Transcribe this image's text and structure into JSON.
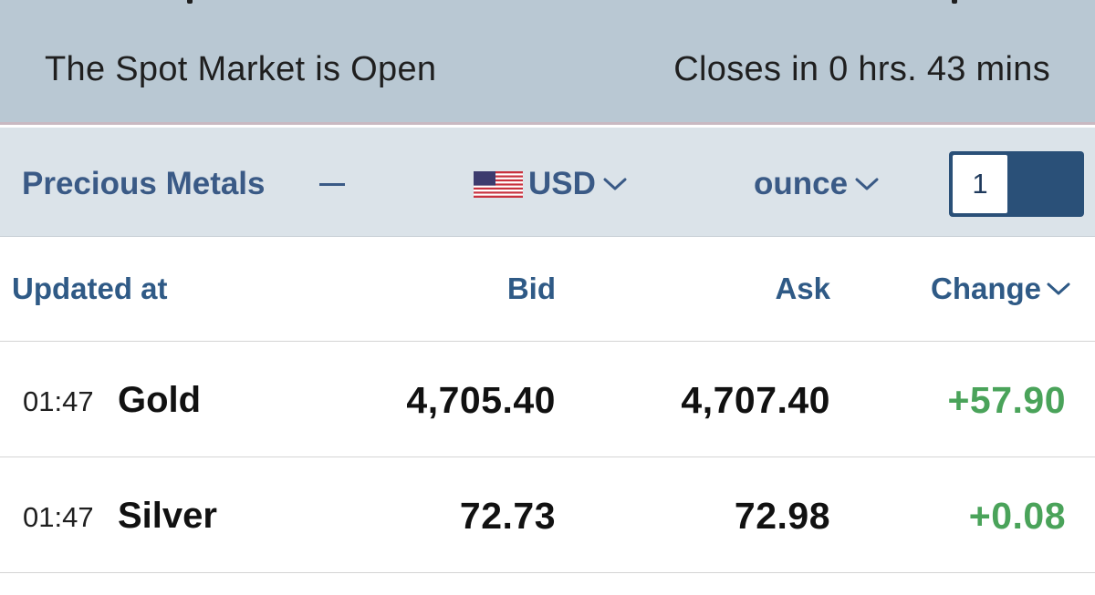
{
  "status": {
    "market_state": "The Spot Market is Open",
    "closing_countdown": "Closes in 0 hrs. 43 mins"
  },
  "filters": {
    "category": "Precious Metals",
    "currency": "USD",
    "currency_flag": "us-flag-icon",
    "unit": "ounce",
    "quantity": "1"
  },
  "table": {
    "columns": {
      "updated": "Updated at",
      "bid": "Bid",
      "ask": "Ask",
      "change": "Change"
    },
    "rows": [
      {
        "time": "01:47",
        "metal": "Gold",
        "bid": "4,705.40",
        "ask": "4,707.40",
        "change": "+57.90"
      },
      {
        "time": "01:47",
        "metal": "Silver",
        "bid": "72.73",
        "ask": "72.98",
        "change": "+0.08"
      }
    ]
  },
  "colors": {
    "banner_bg": "#b9c8d3",
    "filter_bg": "#dbe3e9",
    "accent_blue": "#3a5a86",
    "toggle_blue": "#2a5078",
    "positive_green": "#4aa35a"
  }
}
